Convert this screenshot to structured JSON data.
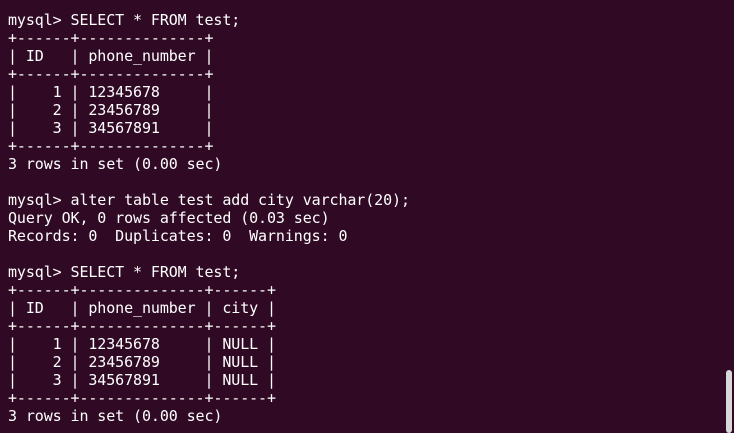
{
  "terminal": {
    "lines": [
      "mysql> SELECT * FROM test;",
      "+------+--------------+",
      "| ID   | phone_number |",
      "+------+--------------+",
      "|    1 | 12345678     |",
      "|    2 | 23456789     |",
      "|    3 | 34567891     |",
      "+------+--------------+",
      "3 rows in set (0.00 sec)",
      "",
      "mysql> alter table test add city varchar(20);",
      "Query OK, 0 rows affected (0.03 sec)",
      "Records: 0  Duplicates: 0  Warnings: 0",
      "",
      "mysql> SELECT * FROM test;",
      "+------+--------------+------+",
      "| ID   | phone_number | city |",
      "+------+--------------+------+",
      "|    1 | 12345678     | NULL |",
      "|    2 | 23456789     | NULL |",
      "|    3 | 34567891     | NULL |",
      "+------+--------------+------+",
      "3 rows in set (0.00 sec)"
    ]
  },
  "colors": {
    "background": "#300a24",
    "text": "#ffffff",
    "scrollbar_thumb": "#d8d8d8"
  }
}
